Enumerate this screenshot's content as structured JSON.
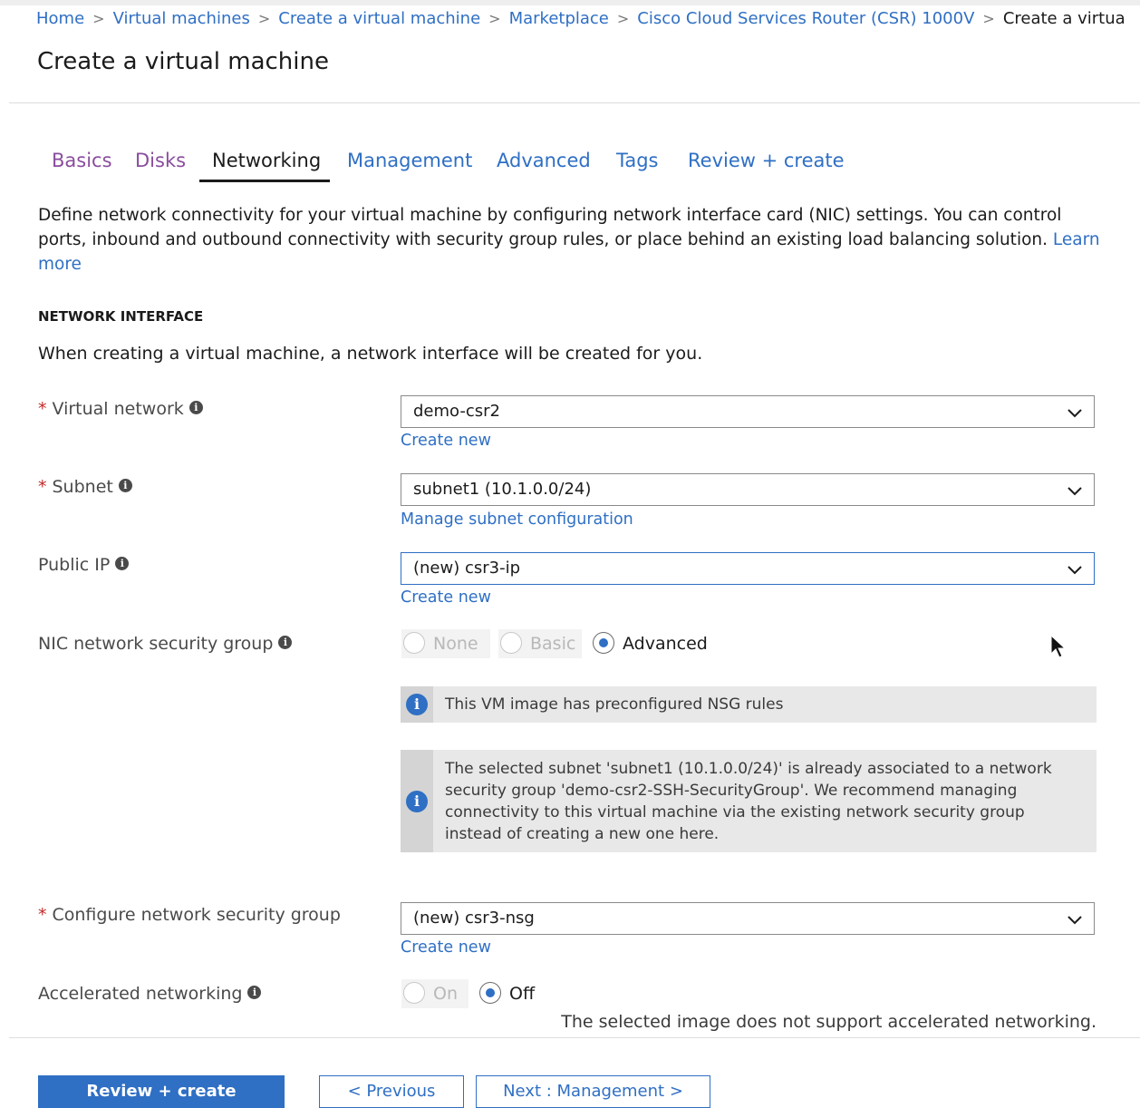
{
  "breadcrumb": {
    "items": [
      "Home",
      "Virtual machines",
      "Create a virtual machine",
      "Marketplace",
      "Cisco Cloud Services Router (CSR) 1000V"
    ],
    "current": "Create a virtua",
    "separator": ">"
  },
  "page_title": "Create a virtual machine",
  "tabs": [
    {
      "label": "Basics",
      "state": "visited"
    },
    {
      "label": "Disks",
      "state": "visited"
    },
    {
      "label": "Networking",
      "state": "active"
    },
    {
      "label": "Management",
      "state": "link"
    },
    {
      "label": "Advanced",
      "state": "link"
    },
    {
      "label": "Tags",
      "state": "link"
    },
    {
      "label": "Review + create",
      "state": "link"
    }
  ],
  "description": {
    "text": "Define network connectivity for your virtual machine by configuring network interface card (NIC) settings. You can control ports, inbound and outbound connectivity with security group rules, or place behind an existing load balancing solution.",
    "link": "Learn more"
  },
  "network_interface": {
    "heading": "NETWORK INTERFACE",
    "text": "When creating a virtual machine, a network interface will be created for you."
  },
  "fields": {
    "virtual_network": {
      "required": "*",
      "label": "Virtual network",
      "value": "demo-csr2",
      "link": "Create new"
    },
    "subnet": {
      "required": "*",
      "label": "Subnet",
      "value": "subnet1 (10.1.0.0/24)",
      "link": "Manage subnet configuration"
    },
    "public_ip": {
      "label": "Public IP",
      "value": "(new) csr3-ip",
      "link": "Create new"
    },
    "nic_nsg": {
      "label": "NIC network security group",
      "options": [
        "None",
        "Basic",
        "Advanced"
      ],
      "selected": "Advanced"
    },
    "configure_nsg": {
      "required": "*",
      "label": "Configure network security group",
      "value": "(new) csr3-nsg",
      "link": "Create new"
    },
    "accelerated_networking": {
      "label": "Accelerated networking",
      "options": [
        "On",
        "Off"
      ],
      "selected": "Off",
      "note": "The selected image does not support accelerated networking."
    }
  },
  "notices": {
    "nsg_rules": "This VM image has preconfigured NSG rules",
    "subnet_nsg": "The selected subnet 'subnet1 (10.1.0.0/24)' is already associated to a network security group 'demo-csr2-SSH-SecurityGroup'. We recommend managing connectivity to this virtual machine via the existing network security group instead of creating a new one here."
  },
  "icons": {
    "info": "info-icon",
    "chevron": "chevron-down-icon",
    "cursor": "mouse-pointer-icon"
  },
  "footer": {
    "review_create": "Review + create",
    "previous": "< Previous",
    "next": "Next : Management >"
  },
  "colors": {
    "link": "#2f6fc4",
    "visited": "#8a4d9d",
    "required": "#c62828",
    "primary": "#2f6fc4"
  }
}
